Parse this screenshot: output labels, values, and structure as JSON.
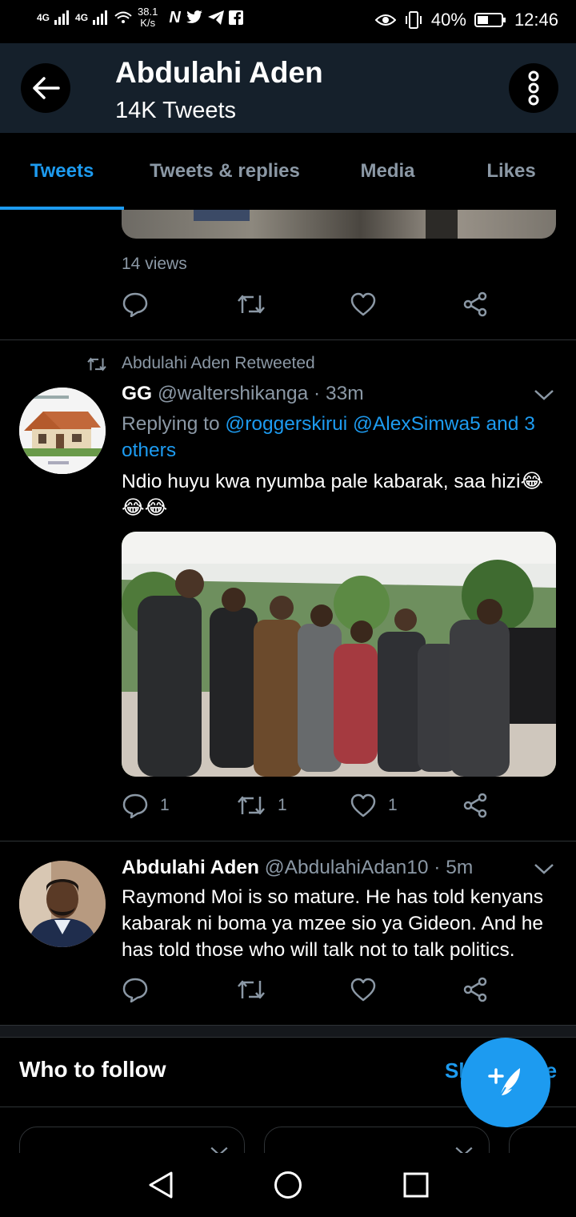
{
  "status_bar": {
    "signal1": "4G",
    "signal2": "4G",
    "speed_value": "38.1",
    "speed_unit": "K/s",
    "battery": "40%",
    "time": "12:46"
  },
  "header": {
    "title": "Abdulahi Aden",
    "subtitle": "14K Tweets"
  },
  "tabs": [
    {
      "label": "Tweets"
    },
    {
      "label": "Tweets & replies"
    },
    {
      "label": "Media"
    },
    {
      "label": "Likes"
    }
  ],
  "prev_tweet": {
    "views": "14 views"
  },
  "retweet": {
    "retweeted_label": "Abdulahi Aden Retweeted",
    "display_name": "GG",
    "handle": "@waltershikanga",
    "time": "· 33m",
    "replying_prefix": "Replying to",
    "replying_to": "@roggerskirui @AlexSimwa5 and 3 others",
    "text": "Ndio huyu kwa nyumba pale kabarak, saa hizi😂😂😂",
    "reply_count": "1",
    "retweet_count": "1",
    "like_count": "1"
  },
  "tweet2": {
    "display_name": "Abdulahi Aden",
    "handle": "@AbdulahiAdan10",
    "time": "· 5m",
    "text": "Raymond Moi is so mature. He has told kenyans kabarak ni boma ya mzee sio ya Gideon. And he has told those who will talk not to talk politics."
  },
  "who_to_follow": {
    "title": "Who to follow",
    "show_more": "Show more"
  },
  "colors": {
    "accent": "#1d9bf0",
    "header_bg": "#15202b",
    "muted_text": "#8b98a5",
    "background": "#000000"
  }
}
